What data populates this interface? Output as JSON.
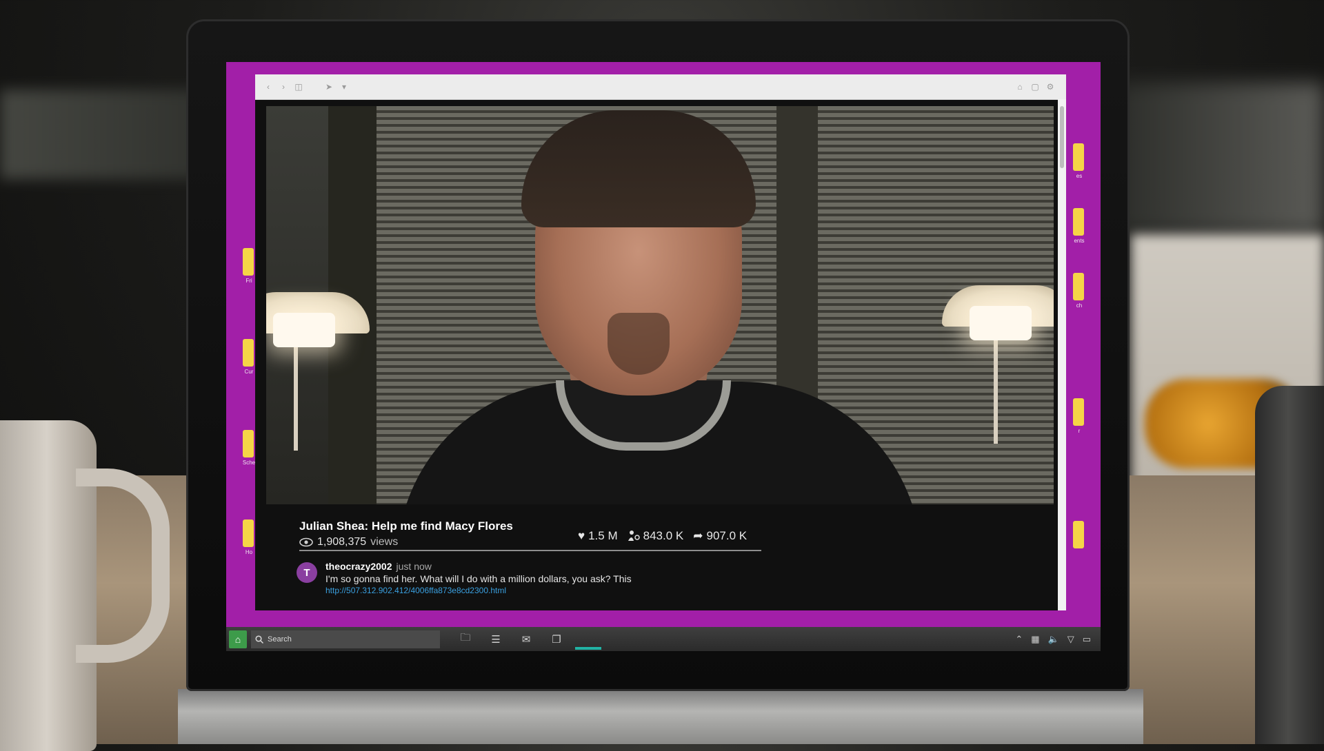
{
  "browser": {
    "nav_back": "‹",
    "nav_forward": "›",
    "nav_reader": "◫",
    "nav_cursor": "➤",
    "nav_menu": "▾",
    "action_home": "⌂",
    "action_share": "▢",
    "action_settings": "⚙"
  },
  "video": {
    "title": "Julian Shea: Help me find Macy Flores",
    "views_count": "1,908,375",
    "views_label": "views",
    "likes": "1.5 M",
    "reactions": "843.0 K",
    "shares": "907.0 K"
  },
  "comments": [
    {
      "avatar_initial": "T",
      "user": "theocrazy2002",
      "time": "just now",
      "text": "I'm so gonna find her.  What will I do with a million dollars, you ask?  This",
      "link": "http://507.312.902.412/4006ffa873e8cd2300.html"
    }
  ],
  "taskbar": {
    "start_icon": "⌂",
    "search_placeholder": "Search",
    "apps": [
      "folder-icon",
      "list-icon",
      "mail-icon",
      "window-icon"
    ],
    "accent_color": "#21b2a4"
  },
  "desktop": {
    "background_color": "#a21fa8",
    "left_icons": [
      "Fri",
      "Cur",
      "Sche",
      "Ho"
    ],
    "right_icons": [
      "es",
      "ents",
      "ch",
      "r",
      ""
    ]
  }
}
